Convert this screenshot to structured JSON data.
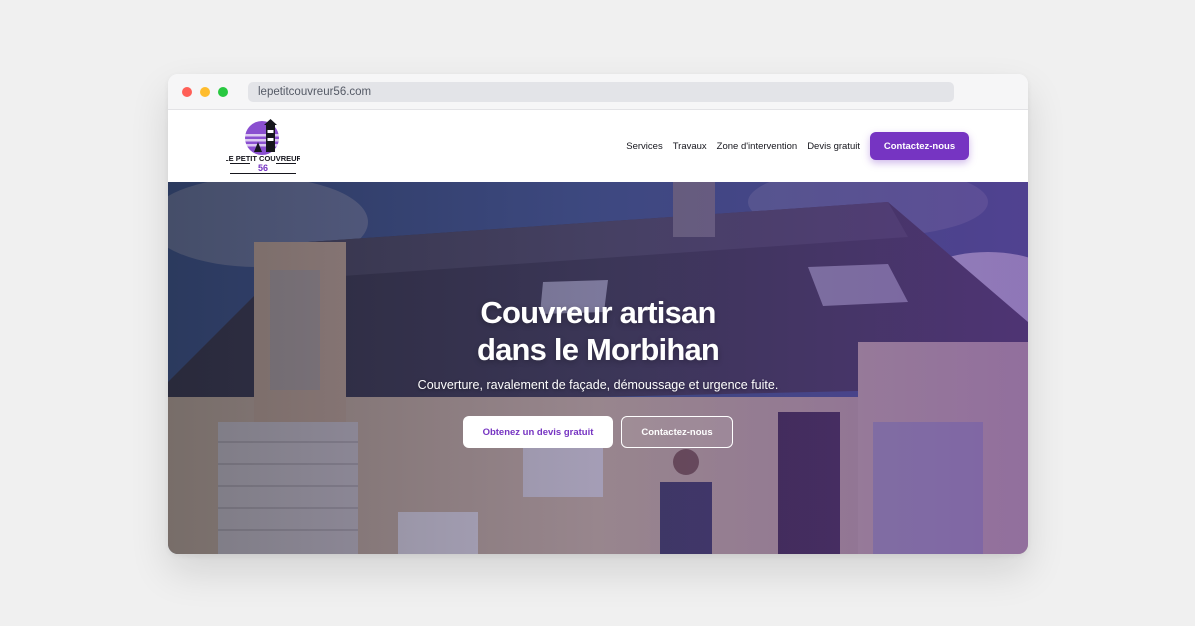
{
  "browser": {
    "url": "lepetitcouvreur56.com"
  },
  "header": {
    "logo": {
      "line1": "LE PETIT COUVREUR",
      "line2": "56"
    },
    "nav": [
      {
        "label": "Services"
      },
      {
        "label": "Travaux"
      },
      {
        "label": "Zone d'intervention"
      },
      {
        "label": "Devis gratuit"
      }
    ],
    "cta_label": "Contactez-nous"
  },
  "hero": {
    "title_line1": "Couvreur artisan",
    "title_line2": "dans le Morbihan",
    "subtitle": "Couverture, ravalement de façade, démoussage et urgence fuite.",
    "primary_button": "Obtenez un devis gratuit",
    "secondary_button": "Contactez-nous"
  },
  "colors": {
    "accent": "#7634c2",
    "white": "#ffffff"
  }
}
